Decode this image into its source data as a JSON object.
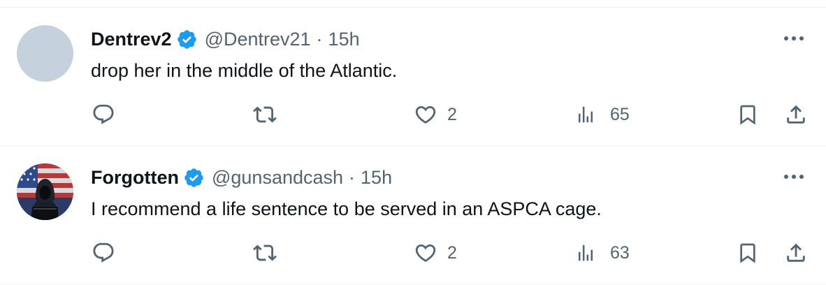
{
  "tweets": [
    {
      "display_name": "Dentrev2",
      "handle": "@Dentrev21",
      "separator": "·",
      "time": "15h",
      "text": "drop her in the middle of the Atlantic.",
      "avatar": "blank-avatar",
      "verified": true,
      "likes": "2",
      "views": "65"
    },
    {
      "display_name": "Forgotten",
      "handle": "@gunsandcash",
      "separator": "·",
      "time": "15h",
      "text": "I recommend a life sentence to be served in an ASPCA cage.",
      "avatar": "hooded-figure-flag-avatar",
      "verified": true,
      "likes": "2",
      "views": "63"
    }
  ],
  "icons": {
    "reply": "reply-icon",
    "retweet": "retweet-icon",
    "like": "like-icon",
    "views": "views-icon",
    "bookmark": "bookmark-icon",
    "share": "share-icon",
    "more": "more-icon",
    "verified": "verified-badge-icon"
  },
  "colors": {
    "text_primary": "#0f1419",
    "text_secondary": "#536471",
    "verified_blue": "#1d9bf0",
    "divider": "#eff3f4",
    "avatar_placeholder": "#c5d1dc"
  }
}
